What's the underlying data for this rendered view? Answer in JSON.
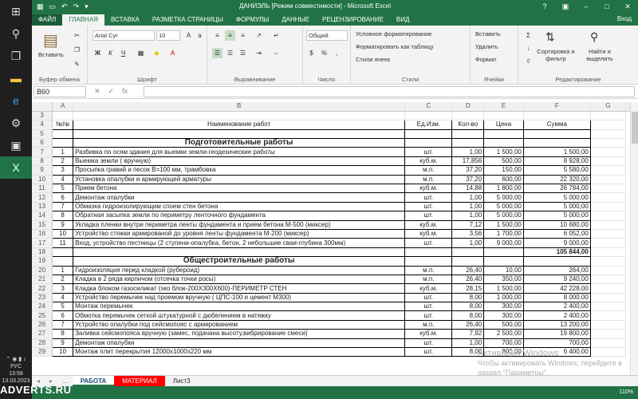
{
  "window": {
    "title": "ДАНИЭЛЬ [Режим совместимости] - Microsoft Excel",
    "login": "Вход"
  },
  "tabs": [
    "ФАЙЛ",
    "ГЛАВНАЯ",
    "ВСТАВКА",
    "РАЗМЕТКА СТРАНИЦЫ",
    "ФОРМУЛЫ",
    "ДАННЫЕ",
    "РЕЦЕНЗИРОВАНИЕ",
    "ВИД"
  ],
  "ribbon": {
    "clipboard": {
      "paste": "Вставить",
      "label": "Буфер обмена"
    },
    "font": {
      "name": "Arial Cyr",
      "size": "10",
      "label": "Шрифт"
    },
    "alignment": {
      "label": "Выравнивание"
    },
    "number": {
      "format": "Общий",
      "label": "Число"
    },
    "styles": {
      "conditional": "Условное форматирование",
      "table": "Форматировать как таблицу",
      "cell": "Стили ячеек",
      "label": "Стили"
    },
    "cells": {
      "insert": "Вставить",
      "delete": "Удалить",
      "format": "Формат",
      "label": "Ячейки"
    },
    "editing": {
      "sort": "Сортировка и фильтр",
      "find": "Найти и выделить",
      "label": "Редактирование"
    }
  },
  "formula_bar": {
    "name_box": "B60",
    "formula": ""
  },
  "columns": [
    "A",
    "B",
    "C",
    "D",
    "E",
    "F",
    "G"
  ],
  "header_row": {
    "num": "№№",
    "name": "Наименование работ",
    "unit": "Ед.Изм.",
    "qty": "Кол-во",
    "price": "Цена",
    "sum": "Сумма"
  },
  "section1": "Подготовительные работы",
  "rows1": [
    {
      "n": "1",
      "name": "Разбивка по осям здания для выемки земли-геодезические работы",
      "unit": "шт.",
      "qty": "1,00",
      "price": "1 500,00",
      "sum": "1 500,00"
    },
    {
      "n": "2",
      "name": "Выемка земли ( вручную)",
      "unit": "куб.м.",
      "qty": "17,856",
      "price": "500,00",
      "sum": "8 928,00"
    },
    {
      "n": "3",
      "name": "Просыпка гравий и песок В=100 мм, трамбовка",
      "unit": "м.п.",
      "qty": "37,20",
      "price": "150,00",
      "sum": "5 580,00"
    },
    {
      "n": "4",
      "name": "Установка опалубки и армирующей арматуры",
      "unit": "м.п.",
      "qty": "37,20",
      "price": "600,00",
      "sum": "22 320,00"
    },
    {
      "n": "5",
      "name": "Прием бетона",
      "unit": "куб.м.",
      "qty": "14,88",
      "price": "1 800,00",
      "sum": "26 784,00"
    },
    {
      "n": "6",
      "name": "Демонтаж опалубки",
      "unit": "шт.",
      "qty": "1,00",
      "price": "5 000,00",
      "sum": "5 000,00"
    },
    {
      "n": "7",
      "name": "Обмазка гидроизолирующим споем стен бетона",
      "unit": "шт.",
      "qty": "1,00",
      "price": "5 000,00",
      "sum": "5 000,00"
    },
    {
      "n": "8",
      "name": "Обратная засыпка земли по периметру ленточного фундамента",
      "unit": "шт.",
      "qty": "1,00",
      "price": "5 000,00",
      "sum": "5 000,00"
    },
    {
      "n": "9",
      "name": "Укладка пленки внутри периметра ленты фундамента и прием бетона М-500 (миксер)",
      "unit": "куб.м.",
      "qty": "7,12",
      "price": "1 500,00",
      "sum": "10 680,00"
    },
    {
      "n": "10",
      "name": "Устройство стяжки армированой до уровня ленты фундамента М-200 (миксер)",
      "unit": "куб.м.",
      "qty": "3,56",
      "price": "1 700,00",
      "sum": "6 052,00"
    },
    {
      "n": "11",
      "name": "Вход, устройство пестницы (2 ступени-опалубка, бетон, 2 небольшие сваи-глубина 300мм)",
      "unit": "шт.",
      "qty": "1,00",
      "price": "9 000,00",
      "sum": "9 000,00"
    }
  ],
  "total1": "105 844,00",
  "section2": "Общестроительные работы",
  "rows2": [
    {
      "n": "1",
      "name": "Гидроизоляция перед кладкой (рубероид)",
      "unit": "м.п.",
      "qty": "26,40",
      "price": "10,00",
      "sum": "264,00"
    },
    {
      "n": "2",
      "name": "Кладка в 2 ряда кирпичом (отсечка точки росы)",
      "unit": "м.п.",
      "qty": "26,40",
      "price": "350,00",
      "sum": "9 240,00"
    },
    {
      "n": "3",
      "name": "Кладка блоком газосиликат (эко блок-200Х300Х600)-ПЕРИМЕТР СТЕН",
      "unit": "куб.м.",
      "qty": "28,15",
      "price": "1 500,00",
      "sum": "42 228,00"
    },
    {
      "n": "4",
      "name": "Устройство перемычек над проемом вручную ( ЦПС-100 и цемент М300)",
      "unit": "шт.",
      "qty": "8,00",
      "price": "1 000,00",
      "sum": "8 000,00"
    },
    {
      "n": "5",
      "name": "Монтаж перемычек",
      "unit": "шт.",
      "qty": "8,00",
      "price": "300,00",
      "sum": "2 400,00"
    },
    {
      "n": "6",
      "name": "Обмотка перемычек сеткой штукатурной с дюбелением в натяжку",
      "unit": "шт.",
      "qty": "8,00",
      "price": "300,00",
      "sum": "2 400,00"
    },
    {
      "n": "7",
      "name": "Устройство опалубки под сейсмопояс с армированием",
      "unit": "м.п.",
      "qty": "26,40",
      "price": "500,00",
      "sum": "13 200,00"
    },
    {
      "n": "8",
      "name": "Заливка сейсмопояса вручную (замес, подачана высоту,вибрирование смеси)",
      "unit": "куб.м.",
      "qty": "7,92",
      "price": "2 500,00",
      "sum": "19 800,00"
    },
    {
      "n": "9",
      "name": "Демонтаж опалубки",
      "unit": "шт.",
      "qty": "1,00",
      "price": "700,00",
      "sum": "700,00"
    },
    {
      "n": "10",
      "name": "Монтаж плит перекрытия 12000х1000х220 мм",
      "unit": "шт.",
      "qty": "8,00",
      "price": "800,00",
      "sum": "6 400,00"
    }
  ],
  "sheets": [
    "РАБОТА",
    "МАТЕРИАЛ",
    "Лист3"
  ],
  "status": {
    "zoom": "110%"
  },
  "taskbar": {
    "lang": "РУС",
    "time": "13:58",
    "date": "13.03.2023"
  },
  "activation": {
    "line1": "Активация Windows",
    "line2": "Чтобы активировать Windows, перейдите в",
    "line3": "раздел \"Параметры\"."
  },
  "watermark": "ADVERTS.RU"
}
